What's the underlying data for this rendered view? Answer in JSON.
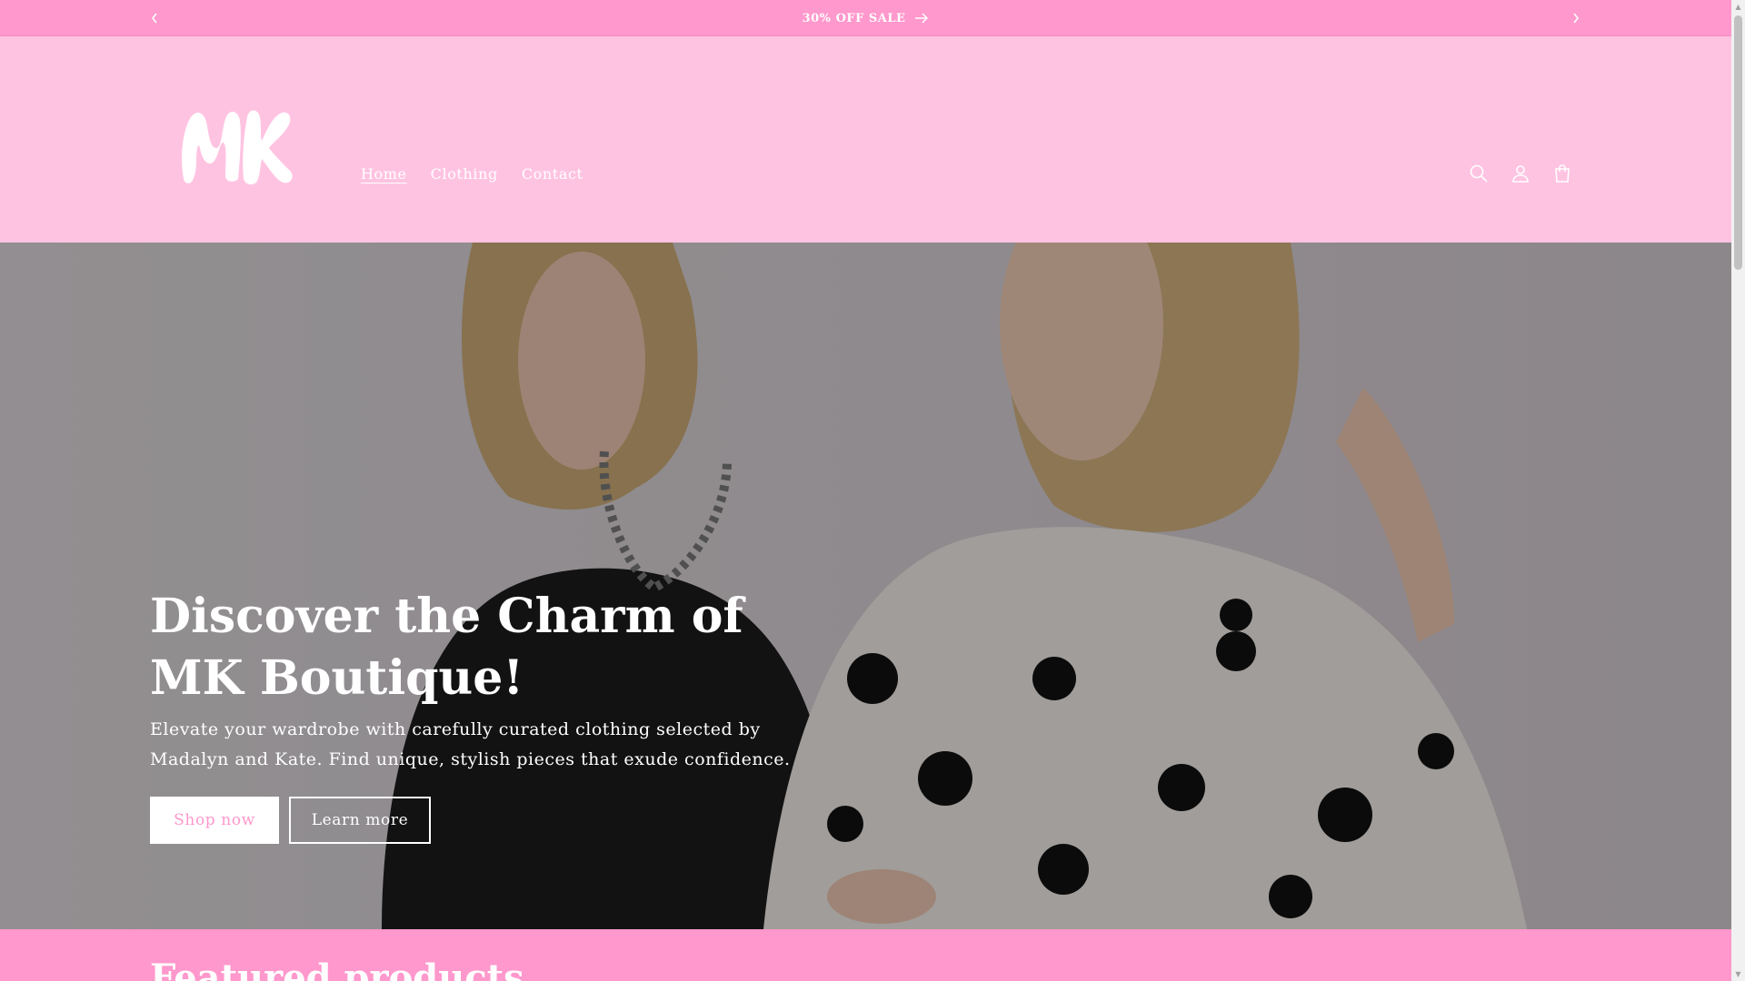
{
  "announcement": {
    "text": "30% OFF SALE",
    "prev_icon": "chevron-left-icon",
    "next_icon": "chevron-right-icon",
    "arrow_icon": "arrow-right-icon"
  },
  "header": {
    "logo_text": "MK",
    "nav": [
      {
        "label": "Home",
        "active": true
      },
      {
        "label": "Clothing",
        "active": false
      },
      {
        "label": "Contact",
        "active": false
      }
    ],
    "icons": [
      "search-icon",
      "account-icon",
      "cart-icon"
    ]
  },
  "hero": {
    "title": "Discover the Charm of MK Boutique!",
    "subtitle": "Elevate your wardrobe with carefully curated clothing selected by Madalyn and Kate. Find unique, stylish pieces that exude confidence.",
    "primary_button": "Shop now",
    "secondary_button": "Learn more"
  },
  "featured": {
    "title": "Featured products"
  },
  "colors": {
    "announcement_bg": "#ff98cc",
    "header_bg": "#ffc3e2",
    "accent": "#ff98cc",
    "text_light": "#ffffff"
  }
}
